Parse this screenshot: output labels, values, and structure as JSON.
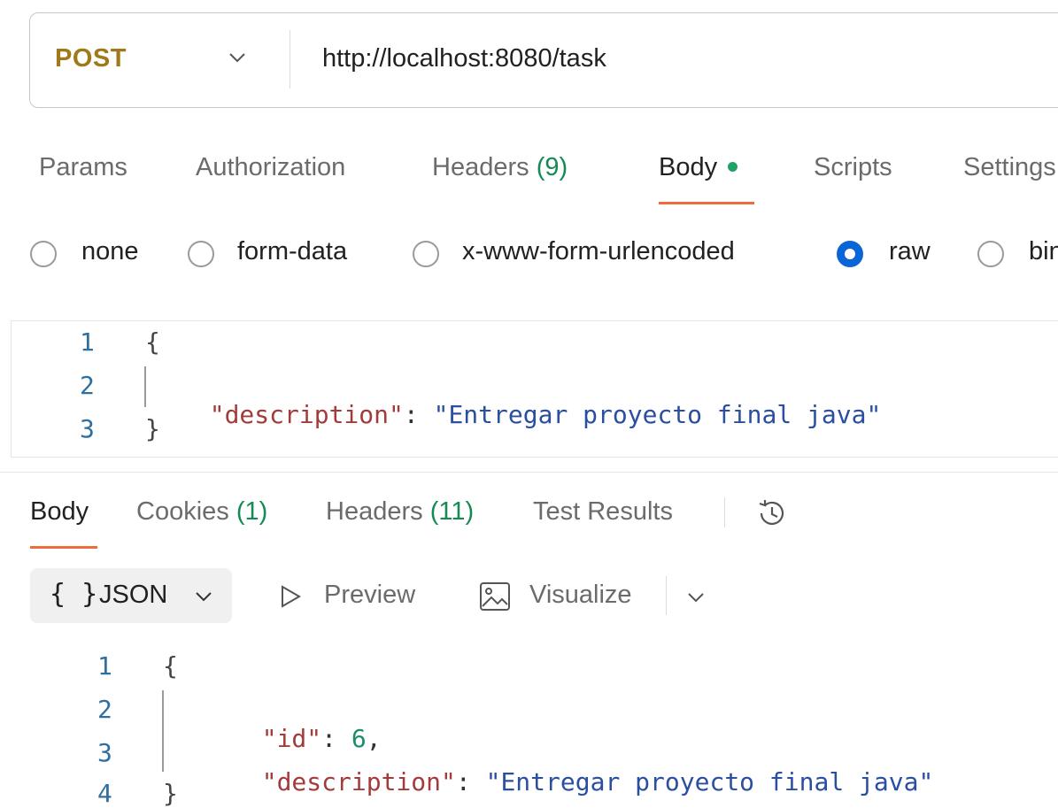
{
  "request": {
    "method": "POST",
    "url": "http://localhost:8080/task"
  },
  "request_tabs": {
    "params": "Params",
    "authorization": "Authorization",
    "headers_label": "Headers",
    "headers_count": "(9)",
    "body": "Body",
    "scripts": "Scripts",
    "settings": "Settings"
  },
  "body_types": {
    "none": "none",
    "form_data": "form-data",
    "urlencoded": "x-www-form-urlencoded",
    "raw": "raw",
    "binary": "binary",
    "selected": "raw"
  },
  "request_body": {
    "line_numbers": [
      "1",
      "2",
      "3"
    ],
    "open_brace": "{",
    "close_brace": "}",
    "key": "\"description\"",
    "colon": ":",
    "value": "\"Entregar proyecto final java\""
  },
  "response_tabs": {
    "body": "Body",
    "cookies_label": "Cookies",
    "cookies_count": "(1)",
    "headers_label": "Headers",
    "headers_count": "(11)",
    "test_results": "Test Results"
  },
  "response_format": {
    "json_icon": "{ }",
    "json": "JSON",
    "preview": "Preview",
    "visualize": "Visualize"
  },
  "response_body": {
    "line_numbers": [
      "1",
      "2",
      "3",
      "4"
    ],
    "open_brace": "{",
    "close_brace": "}",
    "id_key": "\"id\"",
    "id_value": "6",
    "comma": ",",
    "colon": ":",
    "desc_key": "\"description\"",
    "desc_value": "\"Entregar proyecto final java\""
  },
  "colors": {
    "method": "#a07a1a",
    "count": "#168a53",
    "active_underline": "#f26b3a",
    "radio_selected": "#0a66d6",
    "body_dot": "#1fa265",
    "json_key": "#a33b3b",
    "json_string": "#2a4ea0",
    "json_number": "#1c8d6b"
  },
  "icons": {
    "method_dropdown": "chevron-down-icon",
    "body_dot": "status-dot-icon",
    "history": "history-icon",
    "json_dropdown": "chevron-down-icon",
    "preview": "play-icon",
    "visualize": "image-icon",
    "more": "chevron-down-icon"
  }
}
